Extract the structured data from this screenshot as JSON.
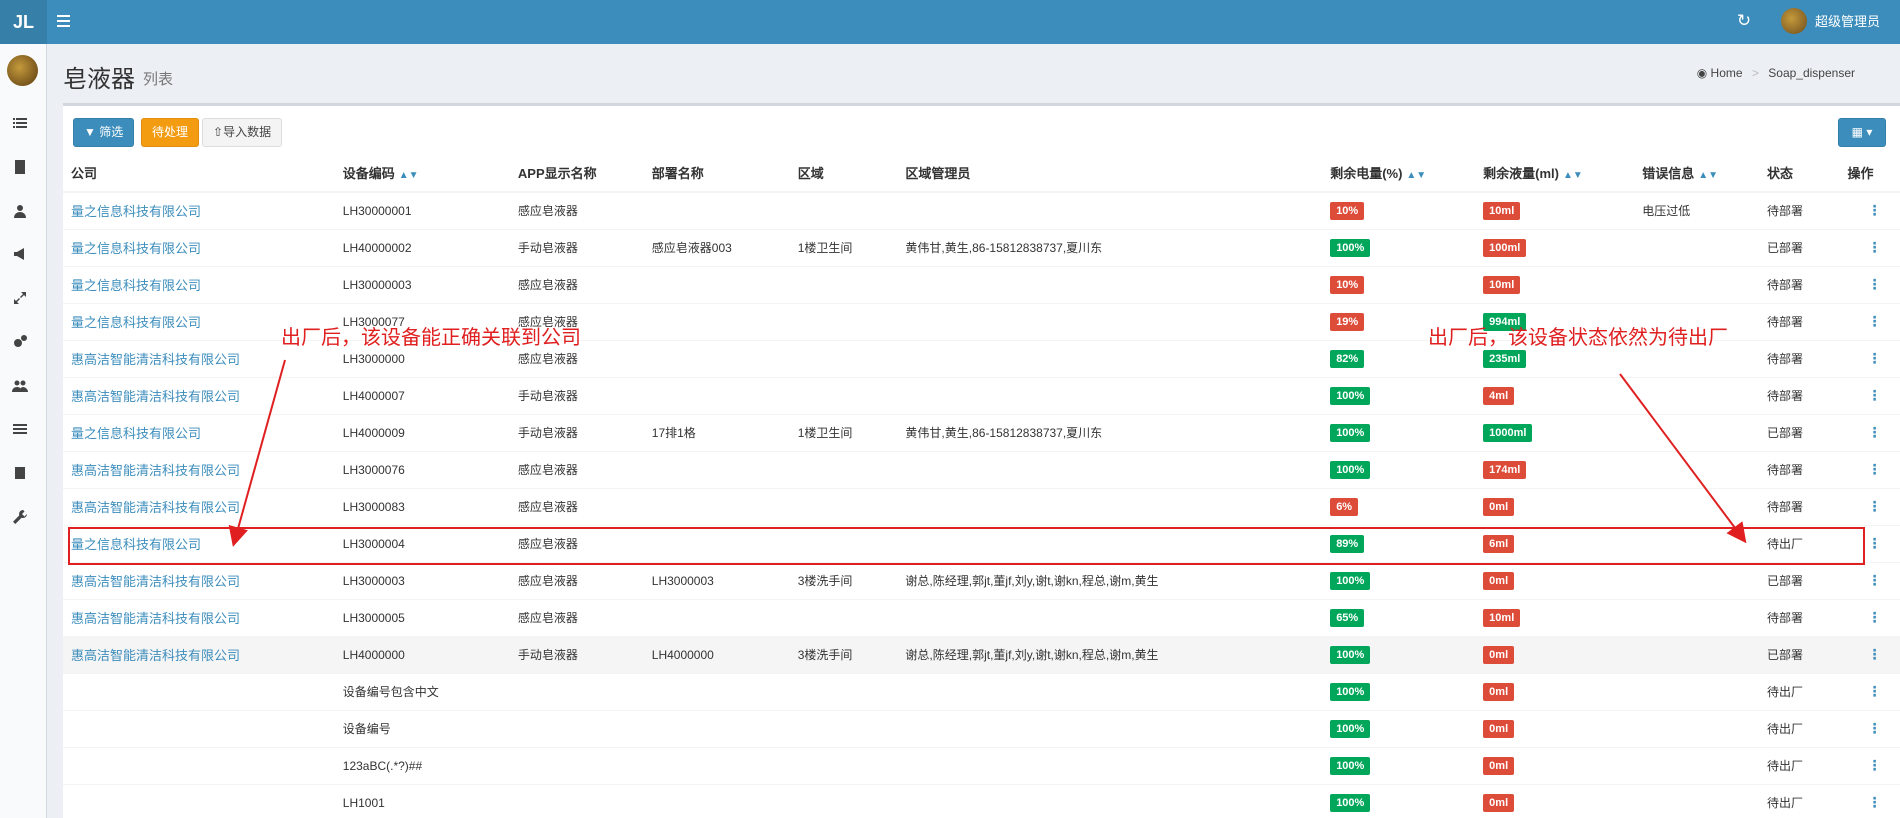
{
  "topbar": {
    "logo": "JL",
    "user_name": "超级管理员"
  },
  "page": {
    "title": "皂液器",
    "subtitle": "列表"
  },
  "breadcrumb": {
    "home": "Home",
    "current": "Soap_dispenser"
  },
  "toolbar": {
    "filter": "筛选",
    "pending": "待处理",
    "import": "导入数据"
  },
  "table": {
    "headers": [
      "公司",
      "设备编码",
      "APP显示名称",
      "部署名称",
      "区域",
      "区域管理员",
      "剩余电量(%)",
      "剩余液量(ml)",
      "错误信息",
      "状态",
      "操作"
    ],
    "rows": [
      {
        "company": "量之信息科技有限公司",
        "code": "LH30000001",
        "app": "感应皂液器",
        "deploy": "",
        "area": "",
        "admin": "",
        "power": "10%",
        "power_ok": false,
        "liquid": "10ml",
        "liquid_ok": false,
        "error": "电压过低",
        "status": "待部署"
      },
      {
        "company": "量之信息科技有限公司",
        "code": "LH40000002",
        "app": "手动皂液器",
        "deploy": "感应皂液器003",
        "area": "1楼卫生间",
        "admin": "黄伟甘,黄生,86-15812838737,夏川东",
        "power": "100%",
        "power_ok": true,
        "liquid": "100ml",
        "liquid_ok": false,
        "error": "",
        "status": "已部署"
      },
      {
        "company": "量之信息科技有限公司",
        "code": "LH30000003",
        "app": "感应皂液器",
        "deploy": "",
        "area": "",
        "admin": "",
        "power": "10%",
        "power_ok": false,
        "liquid": "10ml",
        "liquid_ok": false,
        "error": "",
        "status": "待部署"
      },
      {
        "company": "量之信息科技有限公司",
        "code": "LH3000077",
        "app": "感应皂液器",
        "deploy": "",
        "area": "",
        "admin": "",
        "power": "19%",
        "power_ok": false,
        "liquid": "994ml",
        "liquid_ok": true,
        "error": "",
        "status": "待部署"
      },
      {
        "company": "惠高洁智能清洁科技有限公司",
        "code": "LH3000000",
        "app": "感应皂液器",
        "deploy": "",
        "area": "",
        "admin": "",
        "power": "82%",
        "power_ok": true,
        "liquid": "235ml",
        "liquid_ok": true,
        "error": "",
        "status": "待部署"
      },
      {
        "company": "惠高洁智能清洁科技有限公司",
        "code": "LH4000007",
        "app": "手动皂液器",
        "deploy": "",
        "area": "",
        "admin": "",
        "power": "100%",
        "power_ok": true,
        "liquid": "4ml",
        "liquid_ok": false,
        "error": "",
        "status": "待部署"
      },
      {
        "company": "量之信息科技有限公司",
        "code": "LH4000009",
        "app": "手动皂液器",
        "deploy": "17排1格",
        "area": "1楼卫生间",
        "admin": "黄伟甘,黄生,86-15812838737,夏川东",
        "power": "100%",
        "power_ok": true,
        "liquid": "1000ml",
        "liquid_ok": true,
        "error": "",
        "status": "已部署"
      },
      {
        "company": "惠高洁智能清洁科技有限公司",
        "code": "LH3000076",
        "app": "感应皂液器",
        "deploy": "",
        "area": "",
        "admin": "",
        "power": "100%",
        "power_ok": true,
        "liquid": "174ml",
        "liquid_ok": false,
        "error": "",
        "status": "待部署"
      },
      {
        "company": "惠高洁智能清洁科技有限公司",
        "code": "LH3000083",
        "app": "感应皂液器",
        "deploy": "",
        "area": "",
        "admin": "",
        "power": "6%",
        "power_ok": false,
        "liquid": "0ml",
        "liquid_ok": false,
        "error": "",
        "status": "待部署"
      },
      {
        "company": "量之信息科技有限公司",
        "code": "LH3000004",
        "app": "感应皂液器",
        "deploy": "",
        "area": "",
        "admin": "",
        "power": "89%",
        "power_ok": true,
        "liquid": "6ml",
        "liquid_ok": false,
        "error": "",
        "status": "待出厂"
      },
      {
        "company": "惠高洁智能清洁科技有限公司",
        "code": "LH3000003",
        "app": "感应皂液器",
        "deploy": "LH3000003",
        "area": "3楼洗手间",
        "admin": "谢总,陈经理,郭jt,董jf,刘y,谢t,谢kn,程总,谢m,黄生",
        "power": "100%",
        "power_ok": true,
        "liquid": "0ml",
        "liquid_ok": false,
        "error": "",
        "status": "已部署"
      },
      {
        "company": "惠高洁智能清洁科技有限公司",
        "code": "LH3000005",
        "app": "感应皂液器",
        "deploy": "",
        "area": "",
        "admin": "",
        "power": "65%",
        "power_ok": true,
        "liquid": "10ml",
        "liquid_ok": false,
        "error": "",
        "status": "待部署"
      },
      {
        "company": "惠高洁智能清洁科技有限公司",
        "code": "LH4000000",
        "app": "手动皂液器",
        "deploy": "LH4000000",
        "area": "3楼洗手间",
        "admin": "谢总,陈经理,郭jt,董jf,刘y,谢t,谢kn,程总,谢m,黄生",
        "power": "100%",
        "power_ok": true,
        "liquid": "0ml",
        "liquid_ok": false,
        "error": "",
        "status": "已部署"
      },
      {
        "company": "",
        "code": "设备编号包含中文",
        "app": "",
        "deploy": "",
        "area": "",
        "admin": "",
        "power": "100%",
        "power_ok": true,
        "liquid": "0ml",
        "liquid_ok": false,
        "error": "",
        "status": "待出厂"
      },
      {
        "company": "",
        "code": "设备编号",
        "app": "",
        "deploy": "",
        "area": "",
        "admin": "",
        "power": "100%",
        "power_ok": true,
        "liquid": "0ml",
        "liquid_ok": false,
        "error": "",
        "status": "待出厂"
      },
      {
        "company": "",
        "code": "123aBC(.*?)##",
        "app": "",
        "deploy": "",
        "area": "",
        "admin": "",
        "power": "100%",
        "power_ok": true,
        "liquid": "0ml",
        "liquid_ok": false,
        "error": "",
        "status": "待出厂"
      },
      {
        "company": "",
        "code": "LH1001",
        "app": "",
        "deploy": "",
        "area": "",
        "admin": "",
        "power": "100%",
        "power_ok": true,
        "liquid": "0ml",
        "liquid_ok": false,
        "error": "",
        "status": "待出厂"
      }
    ],
    "hover_row": 12
  },
  "annotations": {
    "left": "出厂后，该设备能正确关联到公司",
    "right": "出厂后，该设备状态依然为待出厂",
    "color": "#e02020"
  }
}
